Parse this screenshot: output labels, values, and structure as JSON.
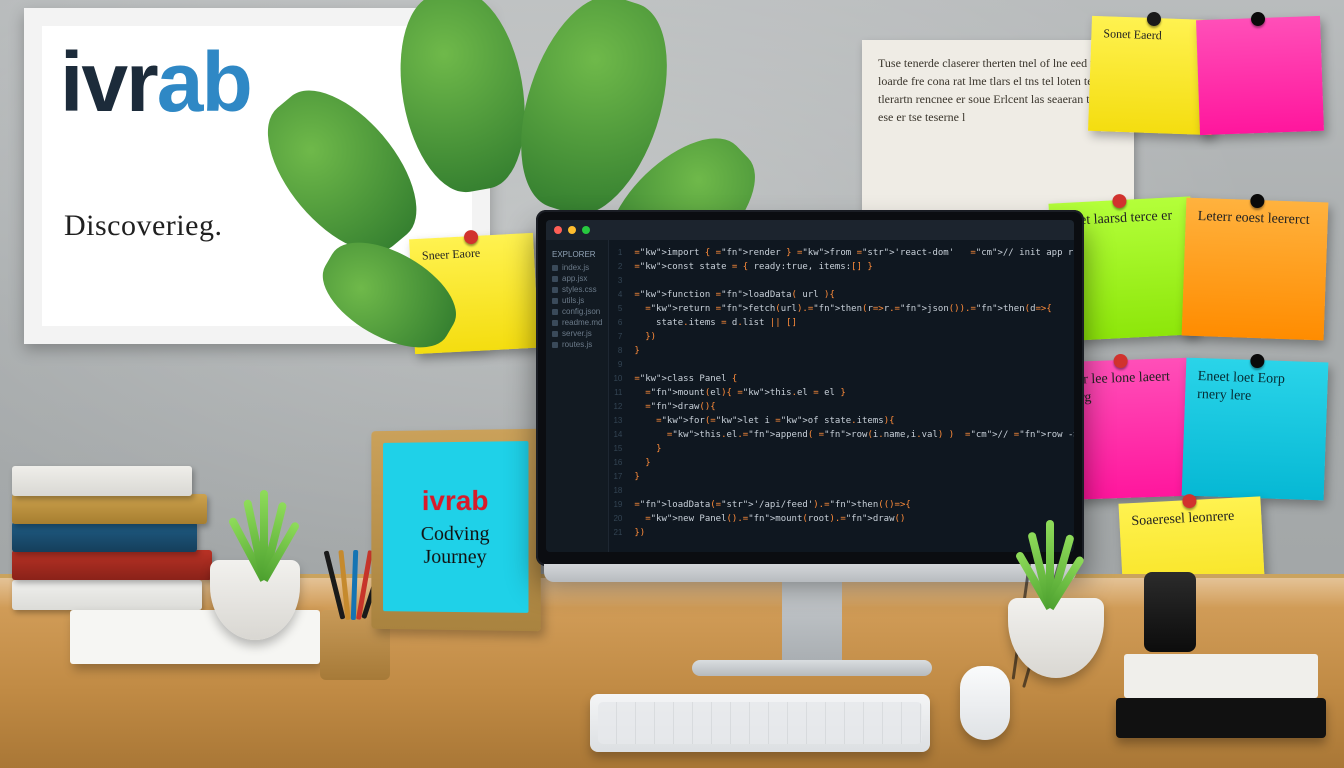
{
  "board": {
    "logo_main": "ivr",
    "logo_accent": "ab",
    "subtitle": "Discoverieg."
  },
  "miniframe": {
    "brand": "ivrab",
    "line1": "Codving",
    "line2": "Journey"
  },
  "notes": {
    "top_yellow1": "Sonet Eaerd",
    "top_pink": "",
    "paper_text": "Tuse tenerde claserer  therten tnel of lne eed tles  loarde fre cona rat  lme tlars el tns tel loten  tenrrt tlerartn rencnee er  soue Erlcent las seaeran  tene ese er tse teserne l",
    "right_green": "Saret laarsd  terce er  lae",
    "right_orange": "Leterr  eoest  leererct",
    "mid_pink": "Soer lee  lone laeert  leorg",
    "mid_cyan": "Eneet loet  Eorp rnery  lere",
    "low_yellow": "Soaeresel  leonrere"
  },
  "small_board_note": "Sneer Eaore",
  "editor": {
    "sidebar_header": "EXPLORER",
    "files": [
      "index.js",
      "app.jsx",
      "styles.css",
      "utils.js",
      "config.json",
      "readme.md",
      "server.js",
      "routes.js"
    ],
    "code_lines": [
      "import { render } from 'react-dom'   // init app root for the run ",
      "const state = { ready:true, items:[] }",
      "",
      "function loadData( url ){",
      "  return fetch(url).then(r=>r.json()).then(d=>{",
      "    state.items = d.list || []",
      "  })",
      "}",
      "",
      "class Panel {",
      "  mount(el){ this.el = el }",
      "  draw(){",
      "    for(let i of state.items){",
      "      this.el.append( row(i.name,i.val) )  // row -> span{}",
      "    }",
      "  }",
      "}",
      "",
      "loadData('/api/feed').then(()=>{",
      "  new Panel().mount(root).draw()",
      "})"
    ]
  }
}
